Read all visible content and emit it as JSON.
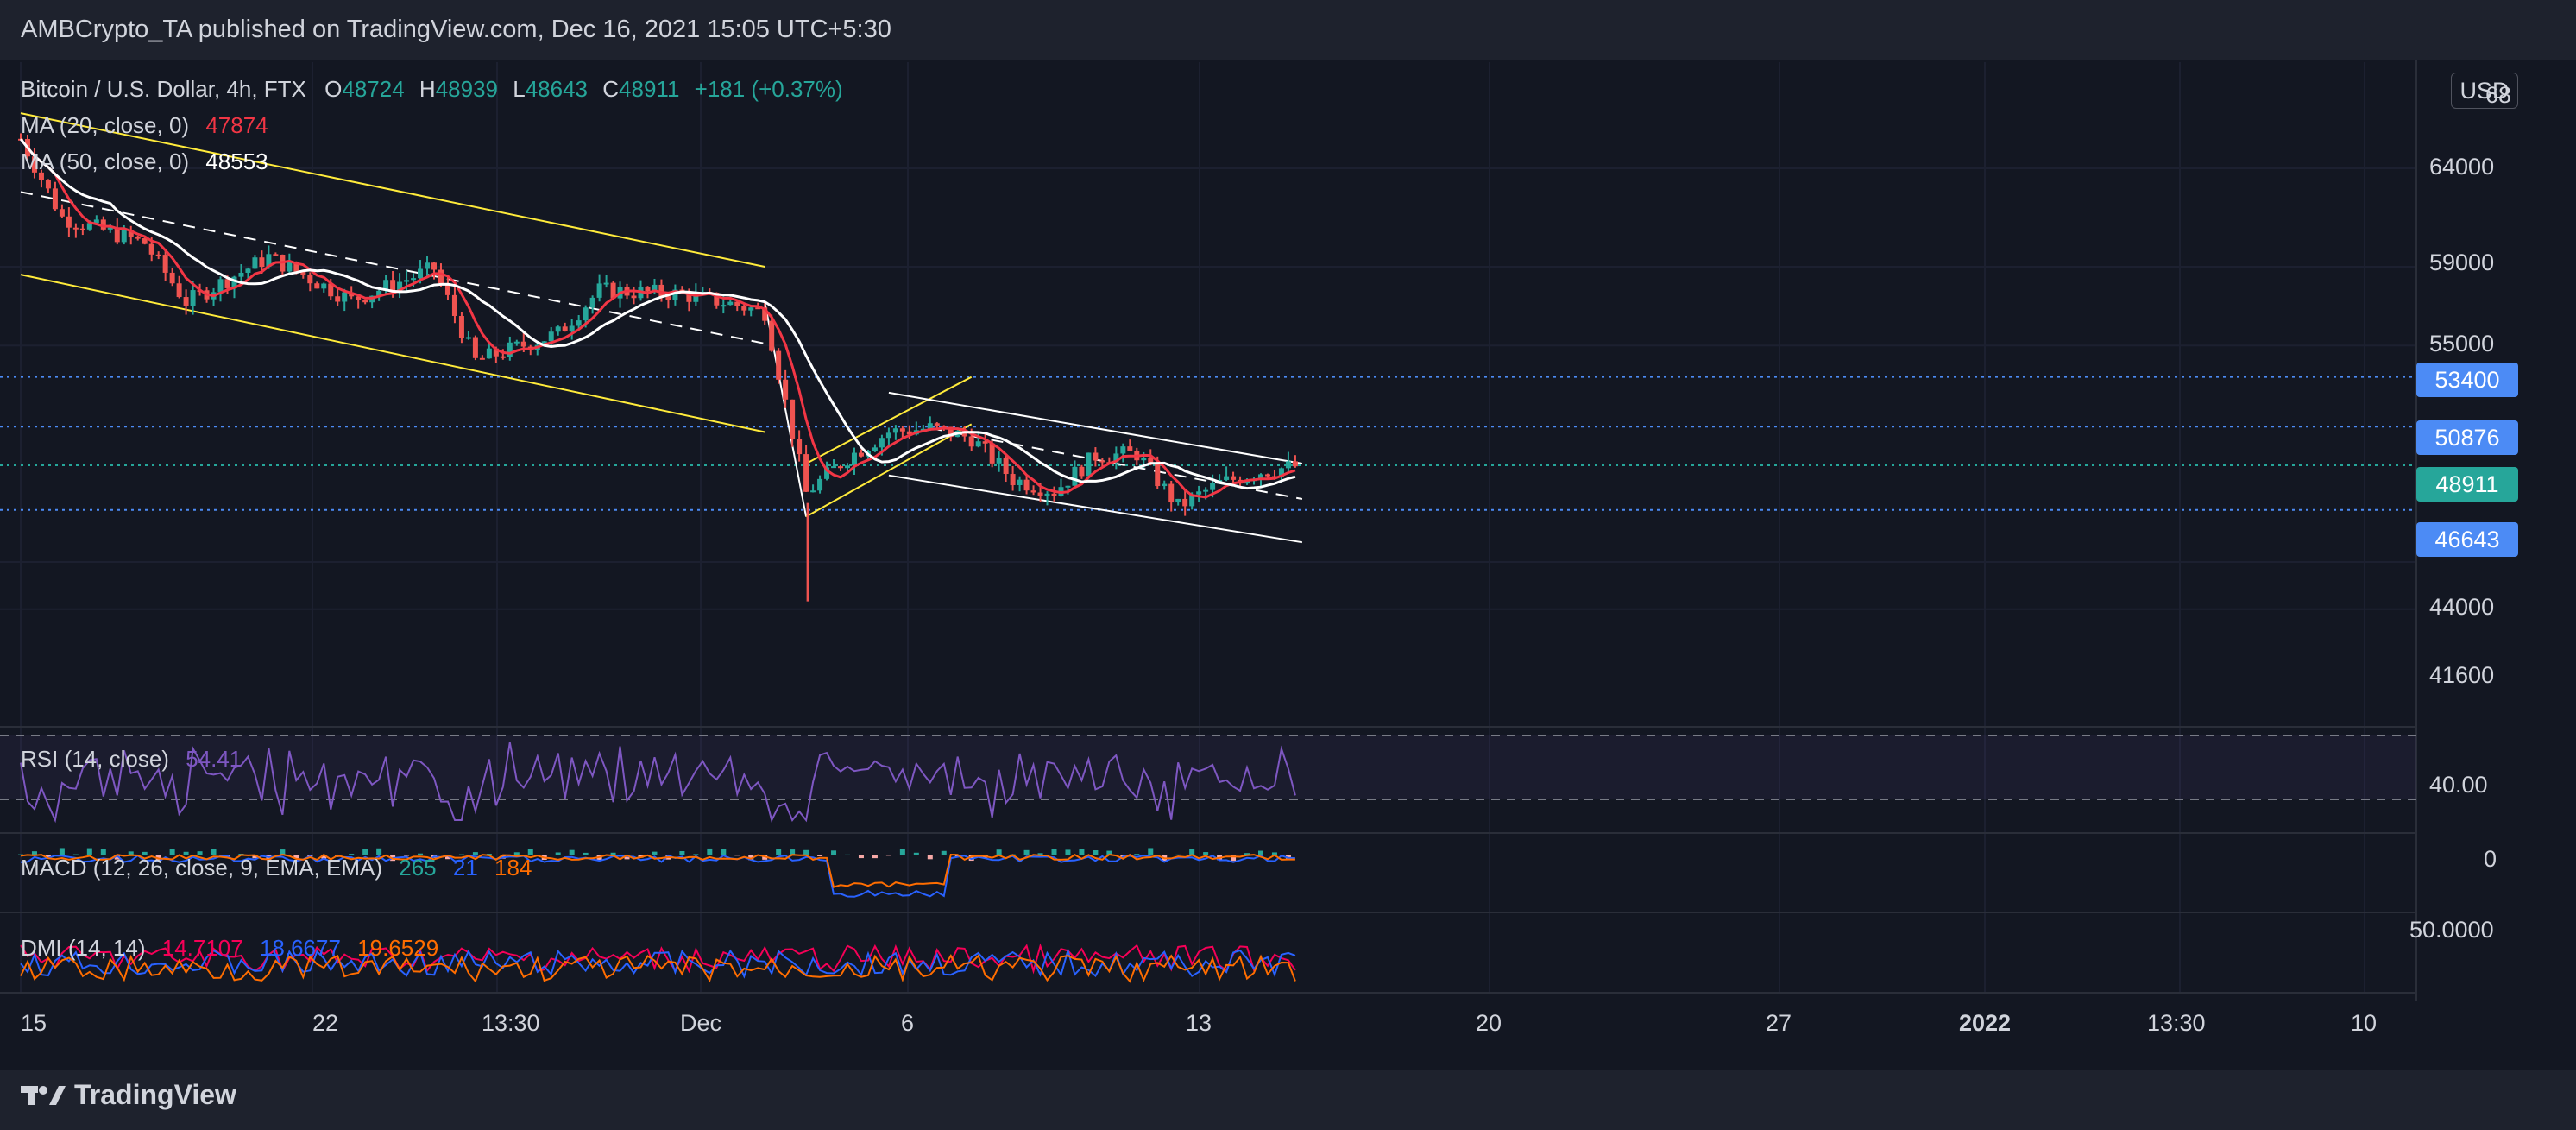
{
  "publisher_line": "AMBCrypto_TA published on TradingView.com, Dec 16, 2021 15:05 UTC+5:30",
  "brand": "TradingView",
  "currency_button": "USD",
  "ohlc_legend": {
    "symbol": "Bitcoin / U.S. Dollar, 4h, FTX",
    "open_label": "O",
    "open": "48724",
    "high_label": "H",
    "high": "48939",
    "low_label": "L",
    "low": "48643",
    "close_label": "C",
    "close": "48911",
    "change": "+181 (+0.37%)"
  },
  "ma20": {
    "label": "MA (20, close, 0)",
    "value": "47874",
    "color": "#f23645"
  },
  "ma50": {
    "label": "MA (50, close, 0)",
    "value": "48553",
    "color": "#ffffff"
  },
  "rsi": {
    "label": "RSI (14, close)",
    "value": "54.41",
    "color": "#7e57c2"
  },
  "macd": {
    "label": "MACD (12, 26, close, 9, EMA, EMA)",
    "v1": "265",
    "v2": "21",
    "v3": "184"
  },
  "dmi": {
    "label": "DMI (14, 14)",
    "v1": "14.7107",
    "v2": "18.6677",
    "v3": "19.6529"
  },
  "price_axis": [
    "64000",
    "59000",
    "55000",
    "44000",
    "41600"
  ],
  "price_axis_top_partial": "68",
  "price_tags": [
    {
      "value": "53400",
      "color": "#4c8bf5"
    },
    {
      "value": "50876",
      "color": "#4c8bf5"
    },
    {
      "value": "48911",
      "color": "#26a69a"
    },
    {
      "value": "46643",
      "color": "#4c8bf5"
    }
  ],
  "rsi_axis": "40.00",
  "macd_axis": "0",
  "dmi_axis": "50.0000",
  "time_axis": [
    "15",
    "22",
    "13:30",
    "Dec",
    "6",
    "13",
    "20",
    "27",
    "2022",
    "13:30",
    "10"
  ],
  "colors": {
    "up": "#26a69a",
    "down": "#ef5350",
    "channel": "#ffeb3b",
    "wedge": "#ffffff",
    "bg": "#131722"
  },
  "chart_data": {
    "type": "candlestick",
    "title": "Bitcoin / U.S. Dollar, 4h, FTX",
    "xlabel": "",
    "ylabel": "USD",
    "x_range": [
      "2021-11-15",
      "2022-01-10"
    ],
    "ylim": [
      40000,
      67000
    ],
    "approx_close_path": [
      {
        "date": "2021-11-15",
        "close": 65500
      },
      {
        "date": "2021-11-16",
        "close": 61500
      },
      {
        "date": "2021-11-18",
        "close": 60200
      },
      {
        "date": "2021-11-19",
        "close": 57200
      },
      {
        "date": "2021-11-21",
        "close": 59500
      },
      {
        "date": "2021-11-23",
        "close": 57300
      },
      {
        "date": "2021-11-25",
        "close": 58900
      },
      {
        "date": "2021-11-26",
        "close": 54200
      },
      {
        "date": "2021-11-28",
        "close": 55600
      },
      {
        "date": "2021-11-29",
        "close": 57800
      },
      {
        "date": "2021-12-01",
        "close": 57600
      },
      {
        "date": "2021-12-02",
        "close": 57200
      },
      {
        "date": "2021-12-03",
        "close": 56700
      },
      {
        "date": "2021-12-04",
        "close": 47500
      },
      {
        "date": "2021-12-05",
        "close": 49300
      },
      {
        "date": "2021-12-06",
        "close": 50600
      },
      {
        "date": "2021-12-07",
        "close": 50800
      },
      {
        "date": "2021-12-08",
        "close": 50300
      },
      {
        "date": "2021-12-09",
        "close": 48200
      },
      {
        "date": "2021-12-10",
        "close": 47600
      },
      {
        "date": "2021-12-11",
        "close": 49400
      },
      {
        "date": "2021-12-12",
        "close": 49500
      },
      {
        "date": "2021-12-13",
        "close": 46800
      },
      {
        "date": "2021-12-14",
        "close": 48000
      },
      {
        "date": "2021-12-15",
        "close": 48600
      },
      {
        "date": "2021-12-16",
        "close": 48911
      }
    ],
    "wick_low": {
      "date": "2021-12-04",
      "low": 42000
    },
    "ma20_last": 47874,
    "ma50_last": 48553,
    "horizontal_levels": [
      53400,
      50876,
      48911,
      46643
    ],
    "grid": true,
    "legend_position": "top-left"
  }
}
